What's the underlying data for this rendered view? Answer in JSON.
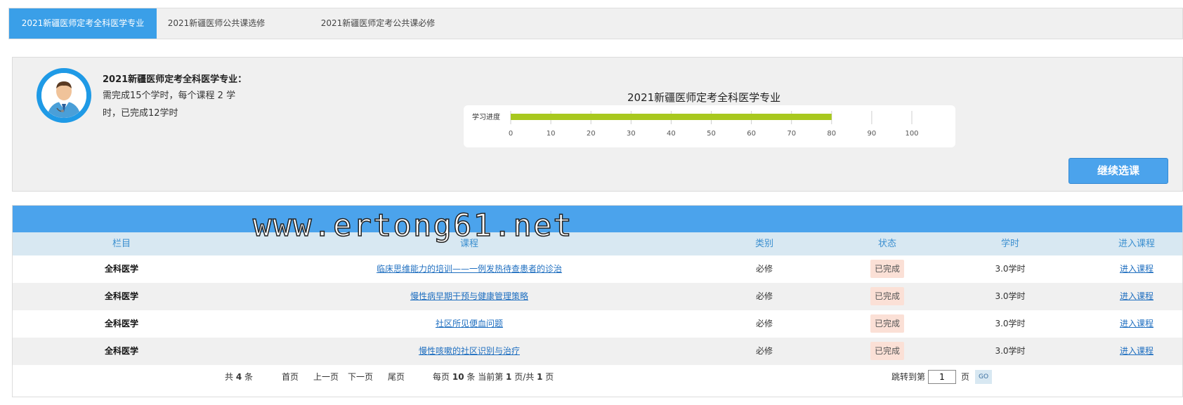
{
  "tabs": [
    {
      "label": "2021新疆医师定考全科医学专业",
      "active": true
    },
    {
      "label": "2021新疆医师公共课选修",
      "active": false
    },
    {
      "label": "2021新疆医师定考公共课必修",
      "active": false
    }
  ],
  "info": {
    "title": "2021新疆医师定考全科医学专业：",
    "desc": "需完成15个学时，每个课程 2 学时，已完成12学时",
    "chart_title": "2021新疆医师定考全科医学专业",
    "continue_label": "继续选课"
  },
  "chart_data": {
    "type": "bar",
    "orientation": "horizontal",
    "title": "2021新疆医师定考全科医学专业",
    "categories": [
      "学习进度"
    ],
    "values": [
      80
    ],
    "xlim": [
      0,
      100
    ],
    "ticks": [
      0,
      10,
      20,
      30,
      40,
      50,
      60,
      70,
      80,
      90,
      100
    ],
    "bar_color": "#a8c81e"
  },
  "table": {
    "headers": {
      "column": "栏目",
      "course": "课程",
      "type": "类别",
      "status": "状态",
      "hours": "学时",
      "enter": "进入课程"
    },
    "rows": [
      {
        "column": "全科医学",
        "course": "临床思维能力的培训——一例发热待查患者的诊治",
        "type": "必修",
        "status": "已完成",
        "hours": "3.0学时",
        "enter": "进入课程"
      },
      {
        "column": "全科医学",
        "course": "慢性病早期干预与健康管理策略",
        "type": "必修",
        "status": "已完成",
        "hours": "3.0学时",
        "enter": "进入课程"
      },
      {
        "column": "全科医学",
        "course": "社区所见便血问题",
        "type": "必修",
        "status": "已完成",
        "hours": "3.0学时",
        "enter": "进入课程"
      },
      {
        "column": "全科医学",
        "course": "慢性咳嗽的社区识别与治疗",
        "type": "必修",
        "status": "已完成",
        "hours": "3.0学时",
        "enter": "进入课程"
      }
    ]
  },
  "pager": {
    "total_prefix": "共",
    "total": "4",
    "total_suffix": "条",
    "first": "首页",
    "prev": "上一页",
    "next": "下一页",
    "last": "尾页",
    "per_page_prefix": "每页",
    "per_page": "10",
    "per_page_mid": "条 当前第",
    "current": "1",
    "page_sep": "页/共",
    "pages": "1",
    "page_suffix": "页",
    "jump_label": "跳转到第",
    "jump_value": "1",
    "jump_suffix": "页",
    "go_label": "GO"
  },
  "watermark": "www.ertong61.net",
  "colors": {
    "accent": "#3a9fe8",
    "progress": "#a8c81e",
    "status_bg": "#fbe0d6"
  }
}
